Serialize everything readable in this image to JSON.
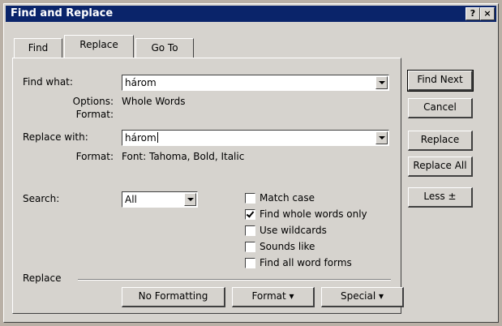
{
  "window": {
    "title": "Find and Replace",
    "help_label": "?",
    "close_label": "×"
  },
  "tabs": [
    {
      "label": "Find"
    },
    {
      "label": "Replace"
    },
    {
      "label": "Go To"
    }
  ],
  "find": {
    "label": "Find what:",
    "value": "három",
    "options_label": "Options:",
    "options_value": "Whole Words",
    "format_label": "Format:"
  },
  "replace": {
    "label": "Replace with:",
    "value": "három",
    "format_label": "Format:",
    "format_value": "Font: Tahoma, Bold, Italic"
  },
  "search": {
    "label": "Search:",
    "value": "All"
  },
  "checkboxes": [
    {
      "label": "Match case",
      "checked": false
    },
    {
      "label": "Find whole words only",
      "checked": true
    },
    {
      "label": "Use wildcards",
      "checked": false
    },
    {
      "label": "Sounds like",
      "checked": false
    },
    {
      "label": "Find all word forms",
      "checked": false
    }
  ],
  "side_buttons": {
    "find_next": "Find Next",
    "cancel": "Cancel",
    "replace": "Replace",
    "replace_all": "Replace All",
    "less": "Less ±"
  },
  "bottom": {
    "group_label": "Replace",
    "no_formatting": "No Formatting",
    "format": "Format ▾",
    "special": "Special ▾"
  }
}
